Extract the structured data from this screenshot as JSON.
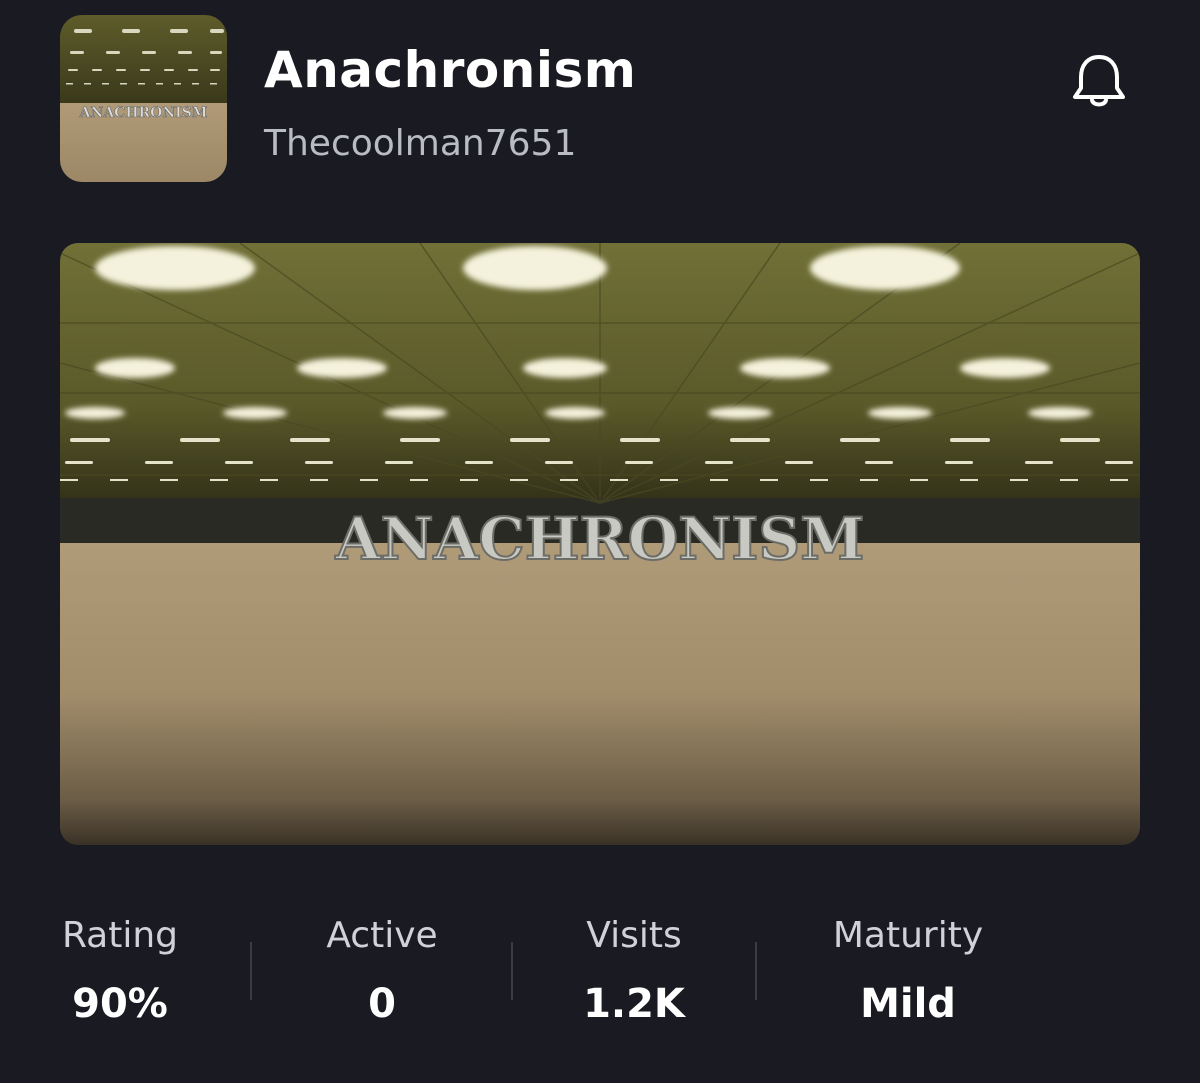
{
  "game": {
    "title": "Anachronism",
    "creator": "Thecoolman7651",
    "thumbnail_text": "ANACHRONISM",
    "icon_text": "ANACHRONISM"
  },
  "notifications": {
    "icon": "bell-icon"
  },
  "stats": [
    {
      "label": "Rating",
      "value": "90%"
    },
    {
      "label": "Active",
      "value": "0"
    },
    {
      "label": "Visits",
      "value": "1.2K"
    },
    {
      "label": "Maturity",
      "value": "Mild"
    }
  ],
  "colors": {
    "background": "#1a1b22",
    "text_primary": "#ffffff",
    "text_secondary": "#b9bcc4",
    "ceiling": "#6e6d36",
    "floor": "#a28d6b"
  }
}
